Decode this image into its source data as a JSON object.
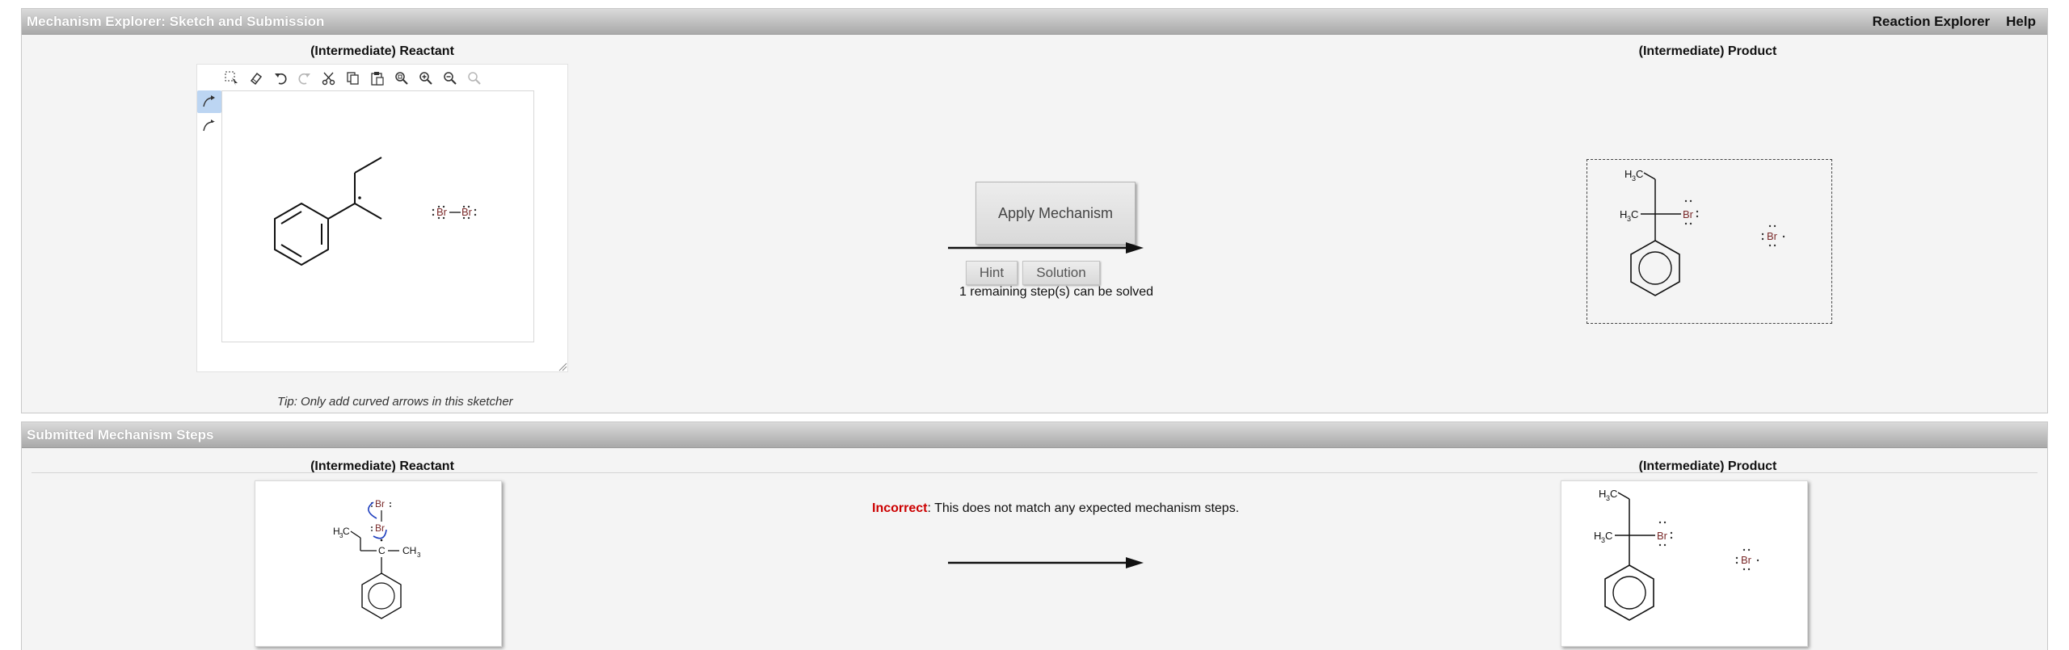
{
  "app": {
    "title": "Mechanism Explorer: Sketch and Submission",
    "nav": [
      "Reaction Explorer",
      "Help"
    ]
  },
  "sketch_section": {
    "reactant_title": "(Intermediate) Reactant",
    "product_title": "(Intermediate) Product",
    "toolbar_icons": [
      "select-icon",
      "erase-icon",
      "undo-icon",
      "redo-icon",
      "cut-icon",
      "copy-icon",
      "paste-icon",
      "zoom-fit-icon",
      "zoom-in-icon",
      "zoom-out-icon",
      "zoom-reset-icon"
    ],
    "side_tools": [
      "curved-arrow-icon",
      "fishhook-arrow-icon"
    ],
    "tip": "Tip: Only add curved arrows in this sketcher",
    "apply_label": "Apply Mechanism",
    "hint_label": "Hint",
    "solution_label": "Solution",
    "remaining_text": "1 remaining step(s) can be solved"
  },
  "submitted_section": {
    "title": "Submitted Mechanism Steps",
    "reactant_title": "(Intermediate) Reactant",
    "product_title": "(Intermediate) Product",
    "feedback_status": "Incorrect",
    "feedback_message": ": This does not match any expected mechanism steps."
  },
  "molecules": {
    "bromine": "Br",
    "methyl": "CH",
    "methyl_left": "H",
    "carbon": "C",
    "subscript_3": "3"
  },
  "colors": {
    "header_gradient_top": "#dadada",
    "header_gradient_bottom": "#a9a9a9",
    "panel_bg": "#f4f4f4",
    "incorrect": "#cc0000",
    "arrow_blue": "#1f3fbf",
    "bromine_text": "#7a2a2a"
  }
}
